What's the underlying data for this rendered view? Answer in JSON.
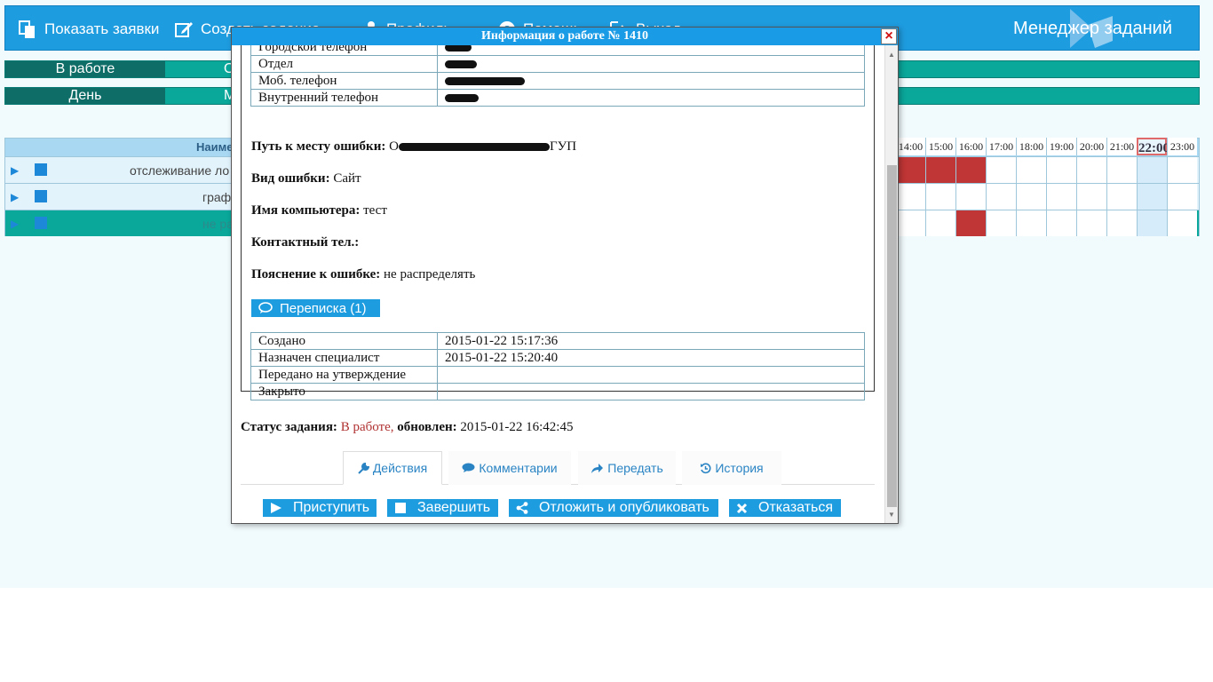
{
  "nav": {
    "show_requests": "Показать заявки",
    "create_task": "Создать задание",
    "profile": "Профиль",
    "help": "Помощь",
    "logout": "Выход",
    "brand": "Менеджер заданий"
  },
  "filters": {
    "status_active": "В работе",
    "status_next": "От",
    "period_active": "День",
    "period_next": "М"
  },
  "grid": {
    "name_header": "Наиме",
    "rows": [
      {
        "name": "отслеживание ло"
      },
      {
        "name": "граф"
      },
      {
        "name": "не ра"
      }
    ],
    "hours": [
      "14:00",
      "15:00",
      "16:00",
      "17:00",
      "18:00",
      "19:00",
      "20:00",
      "21:00",
      "22:00",
      "23:00"
    ],
    "current_hour": "22:00",
    "busy_cells": [
      {
        "row": 0,
        "hour": "14:00"
      },
      {
        "row": 0,
        "hour": "15:00"
      },
      {
        "row": 0,
        "hour": "16:00"
      },
      {
        "row": 2,
        "hour": "16:00"
      }
    ],
    "busy_color": "#c03535"
  },
  "modal": {
    "title": "Информация о работе № 1410",
    "close_label": "×",
    "contact_rows": [
      {
        "label": "Городской телефон",
        "value": ""
      },
      {
        "label": "Отдел",
        "value": ""
      },
      {
        "label": "Моб. телефон",
        "value": ""
      },
      {
        "label": "Внутренний телефон",
        "value": ""
      }
    ],
    "path_label": "Путь к месту ошибки:",
    "path_value": "О",
    "path_tail": "ГУП",
    "error_type_label": "Вид ошибки:",
    "error_type_value": "Сайт",
    "computer_label": "Имя компьютера:",
    "computer_value": "тест",
    "contact_phone_label": "Контактный тел.:",
    "contact_phone_value": "",
    "note_label": "Пояснение к ошибке:",
    "note_value": "не распределять",
    "correspondence_button": "Переписка (1)",
    "history_rows": [
      {
        "label": "Создано",
        "value": "2015-01-22 15:17:36"
      },
      {
        "label": "Назначен специалист",
        "value": "2015-01-22 15:20:40"
      },
      {
        "label": "Передано на утверждение",
        "value": ""
      },
      {
        "label": "Закрыто",
        "value": ""
      }
    ],
    "status_label": "Статус задания:",
    "status_value": "В работе,",
    "updated_label": "обновлен:",
    "updated_value": "2015-01-22 16:42:45",
    "tabs": [
      "Действия",
      "Комментарии",
      "Передать",
      "История"
    ],
    "actions": [
      "Приступить",
      "Завершить",
      "Отложить и опубликовать",
      "Отказаться"
    ]
  },
  "colors": {
    "accent": "#1e9ce0",
    "teal": "#0aa79b",
    "teal_dark": "#0f6d68",
    "status_red": "#b03030"
  }
}
